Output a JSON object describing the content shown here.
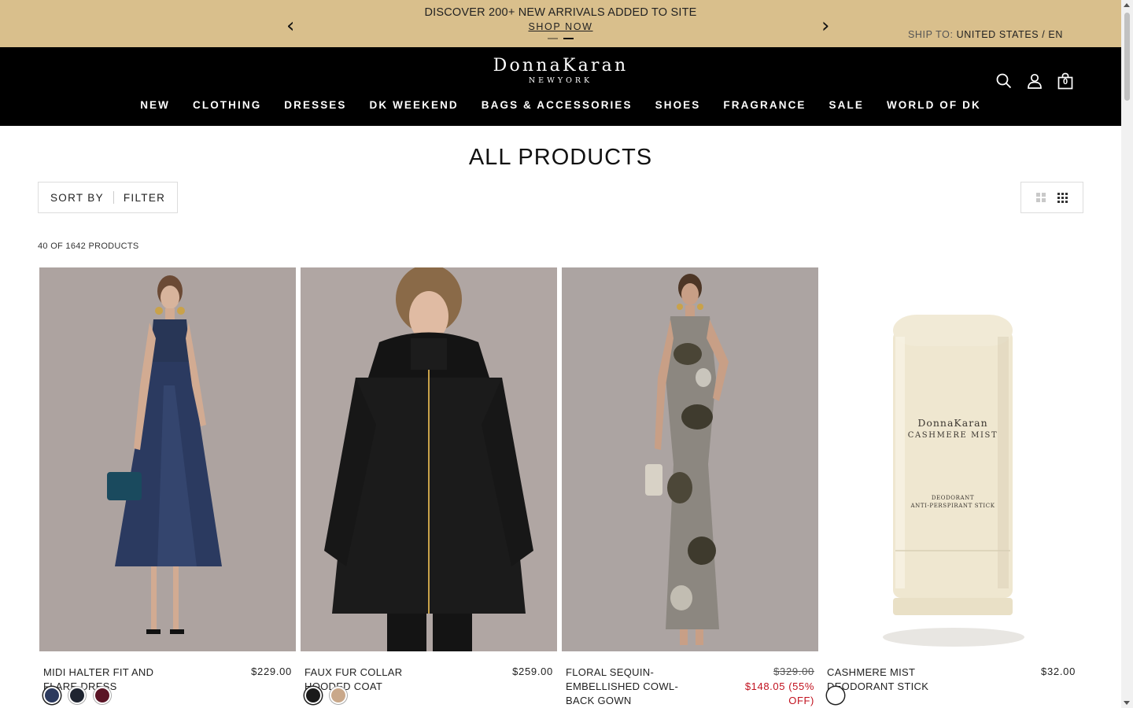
{
  "promo": {
    "prev_icon": "chevron-left",
    "next_icon": "chevron-right",
    "prev_glyph": "‹",
    "next_glyph": "›",
    "message": "DISCOVER 200+ NEW ARRIVALS ADDED TO SITE",
    "link": "SHOP NOW",
    "ship_label": "SHIP TO:",
    "ship_value": "UNITED STATES / EN",
    "slides": 2,
    "active_slide": 2
  },
  "header": {
    "logo_main": "DonnaKaran",
    "logo_sub": "NEWYORK",
    "icons": [
      "search-icon",
      "account-icon",
      "bag-icon"
    ],
    "bag_count": "0",
    "nav": [
      "NEW",
      "CLOTHING",
      "DRESSES",
      "DK WEEKEND",
      "BAGS & ACCESSORIES",
      "SHOES",
      "FRAGRANCE",
      "SALE",
      "WORLD OF DK"
    ]
  },
  "page": {
    "title": "ALL PRODUCTS",
    "sort_label": "SORT BY",
    "filter_label": "FILTER",
    "count_text": "40 OF 1642 PRODUCTS",
    "view_options": [
      "grid-2-icon",
      "grid-3-icon"
    ]
  },
  "products": [
    {
      "name": "MIDI HALTER FIT AND FLARE DRESS",
      "price": "$229.00",
      "swatches": [
        "#2c3a5e",
        "#1f2430",
        "#5b1526"
      ],
      "image": "navy-halter-dress-photo"
    },
    {
      "name": "FAUX FUR COLLAR HOODED COAT",
      "price": "$259.00",
      "swatches": [
        "#1a1a1a",
        "#c9a88a"
      ],
      "image": "black-hooded-coat-photo"
    },
    {
      "name": "FLORAL SEQUIN-EMBELLISHED COWL-BACK GOWN",
      "price_original": "$329.00",
      "price_sale": "$148.05 (55% OFF)",
      "image": "sequin-gown-photo"
    },
    {
      "name": "CASHMERE MIST DEODORANT STICK",
      "price": "$32.00",
      "swatches": [
        "#ffffff"
      ],
      "image": "deodorant-stick-photo",
      "product_label": {
        "brand": "DonnaKaran",
        "line": "CASHMERE MIST",
        "desc1": "DEODORANT",
        "desc2": "ANTI-PERSPIRANT STICK"
      }
    }
  ]
}
